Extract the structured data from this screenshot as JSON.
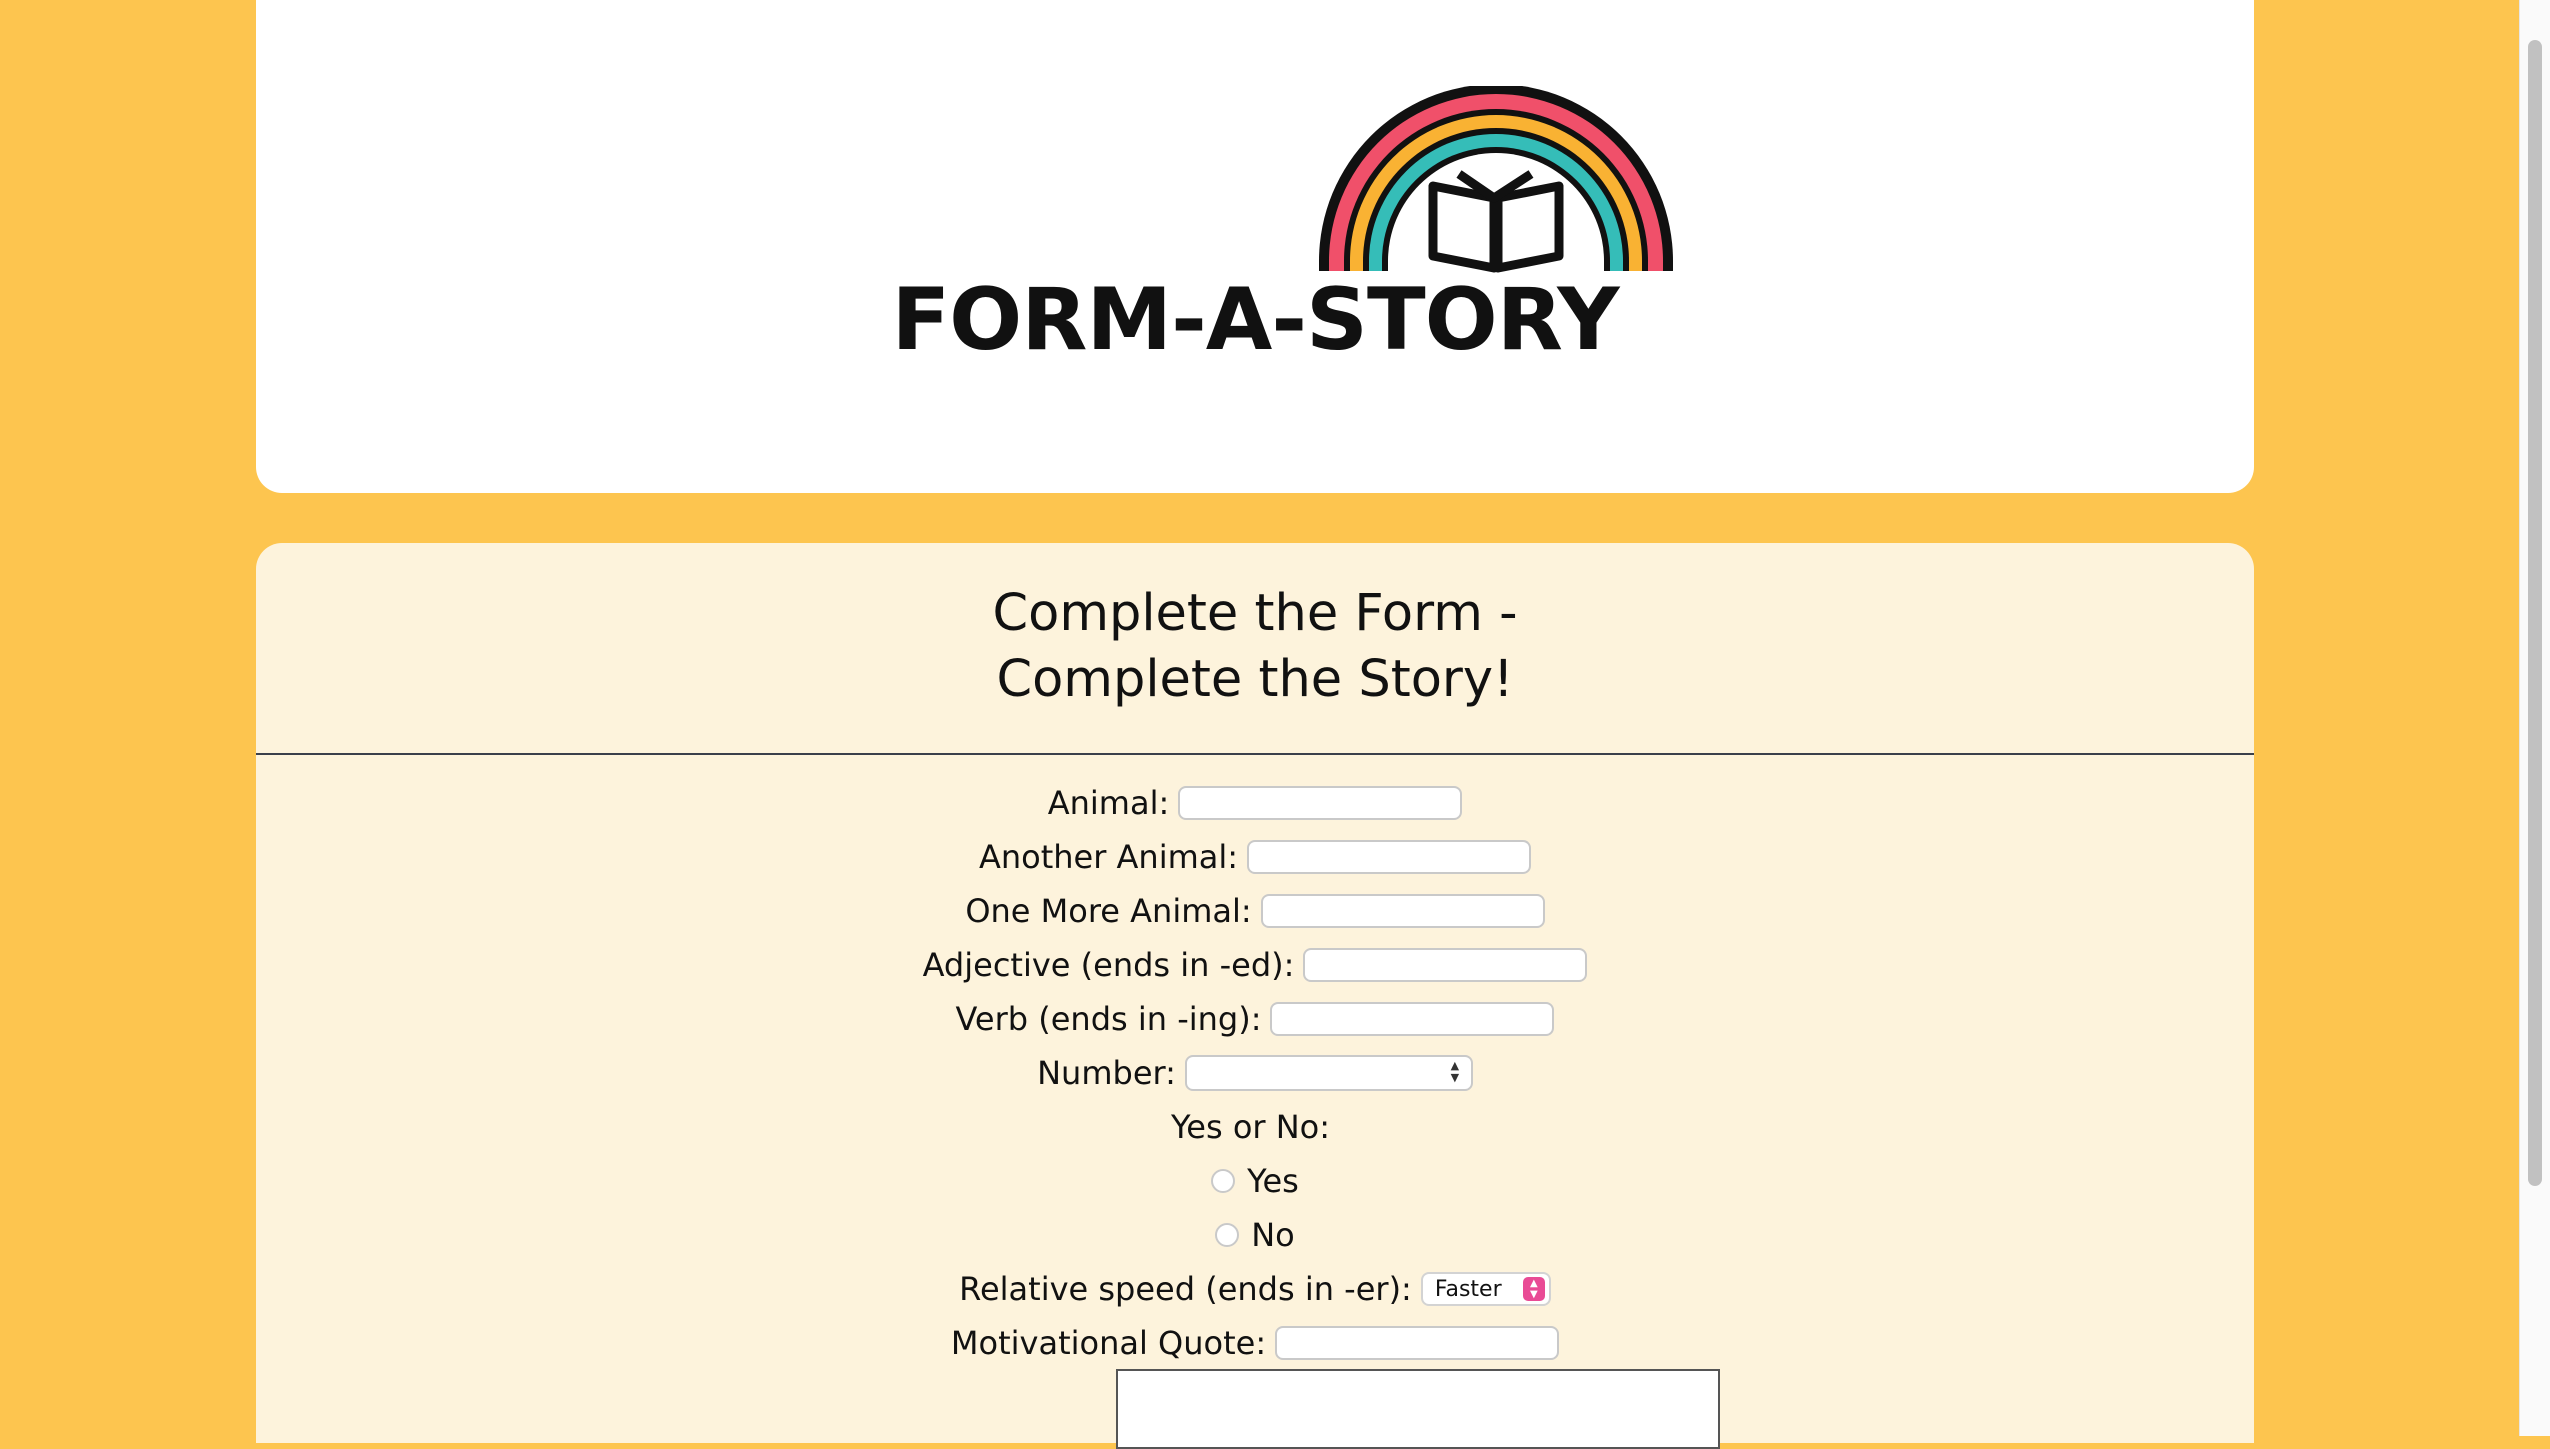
{
  "colors": {
    "page_background": "#FDC54F",
    "form_background": "#FDF3DC",
    "rainbow_outer": "#F0506A",
    "rainbow_middle": "#F9B233",
    "rainbow_inner": "#35BDB8",
    "select_accent": "#E94B95"
  },
  "logo": {
    "icon": "rainbow-book-icon",
    "text": "FORM-A-STORY"
  },
  "form": {
    "title_line1": "Complete the Form -",
    "title_line2": "Complete the Story!",
    "fields": {
      "animal_label": "Animal:",
      "another_animal_label": "Another Animal:",
      "one_more_animal_label": "One More Animal:",
      "adjective_label": "Adjective (ends in -ed):",
      "verb_label": "Verb (ends in -ing):",
      "number_label": "Number:",
      "yes_no_label": "Yes or No:",
      "yes_option": "Yes",
      "no_option": "No",
      "speed_label": "Relative speed (ends in -er):",
      "speed_selected": "Faster",
      "quote_label": "Motivational Quote:"
    },
    "values": {
      "animal": "",
      "another_animal": "",
      "one_more_animal": "",
      "adjective": "",
      "verb": "",
      "number": "",
      "quote": ""
    }
  }
}
